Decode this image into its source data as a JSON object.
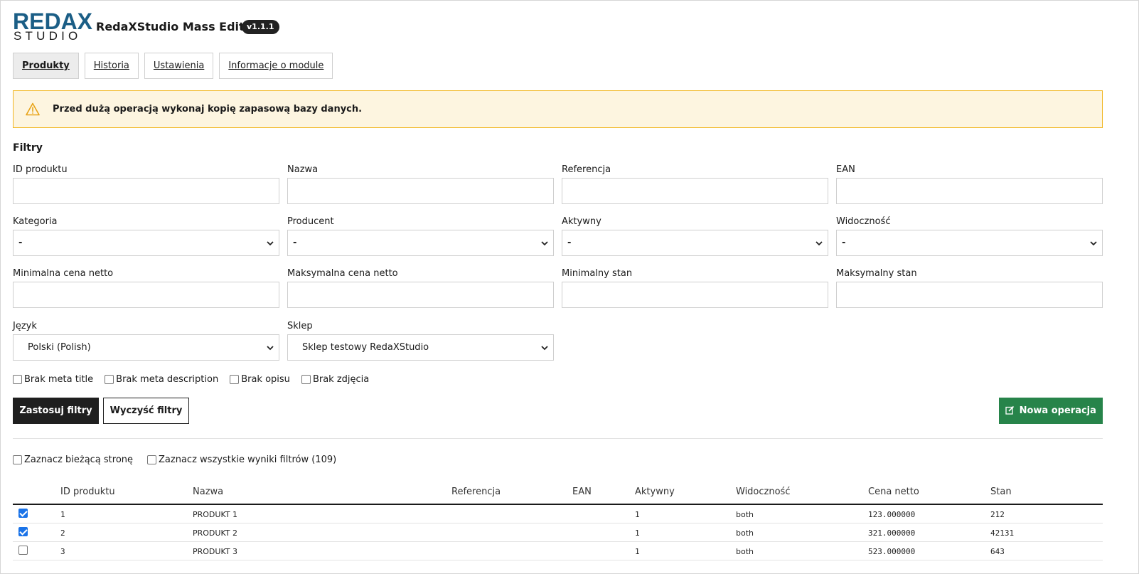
{
  "app": {
    "logo_top": "REDAX",
    "logo_bottom": "STUDIO",
    "title": "RedaXStudio Mass Edit",
    "version": "v1.1.1"
  },
  "tabs": [
    {
      "label": "Produkty",
      "active": true
    },
    {
      "label": "Historia",
      "active": false
    },
    {
      "label": "Ustawienia",
      "active": false
    },
    {
      "label": "Informacje o module",
      "active": false
    }
  ],
  "alert": {
    "icon": "warning-icon",
    "text": "Przed dużą operacją wykonaj kopię zapasową bazy danych."
  },
  "filters": {
    "title": "Filtry",
    "product_id": {
      "label": "ID produktu",
      "value": ""
    },
    "name": {
      "label": "Nazwa",
      "value": ""
    },
    "reference": {
      "label": "Referencja",
      "value": ""
    },
    "ean": {
      "label": "EAN",
      "value": ""
    },
    "category": {
      "label": "Kategoria",
      "value": "-"
    },
    "manufacturer": {
      "label": "Producent",
      "value": "-"
    },
    "active": {
      "label": "Aktywny",
      "value": "-"
    },
    "visibility": {
      "label": "Widoczność",
      "value": "-"
    },
    "min_price": {
      "label": "Minimalna cena netto",
      "value": ""
    },
    "max_price": {
      "label": "Maksymalna cena netto",
      "value": ""
    },
    "min_stock": {
      "label": "Minimalny stan",
      "value": ""
    },
    "max_stock": {
      "label": "Maksymalny stan",
      "value": ""
    },
    "language": {
      "label": "Język",
      "value": "Polski (Polish)"
    },
    "shop": {
      "label": "Sklep",
      "value": "Sklep testowy RedaXStudio"
    },
    "checkboxes": [
      {
        "label": "Brak meta title",
        "checked": false
      },
      {
        "label": "Brak meta description",
        "checked": false
      },
      {
        "label": "Brak opisu",
        "checked": false
      },
      {
        "label": "Brak zdjęcia",
        "checked": false
      }
    ],
    "apply_label": "Zastosuj filtry",
    "clear_label": "Wyczyść filtry",
    "new_operation_label": "Nowa operacja"
  },
  "selection": {
    "current_page_label": "Zaznacz bieżącą stronę",
    "all_results_label": "Zaznacz wszystkie wyniki filtrów (109)"
  },
  "table": {
    "headers": [
      "ID produktu",
      "Nazwa",
      "Referencja",
      "EAN",
      "Aktywny",
      "Widoczność",
      "Cena netto",
      "Stan"
    ],
    "rows": [
      {
        "checked": true,
        "id": "1",
        "name": "PRODUKT 1",
        "reference": "",
        "ean": "",
        "active": "1",
        "visibility": "both",
        "price": "123.000000",
        "stock": "212"
      },
      {
        "checked": true,
        "id": "2",
        "name": "PRODUKT 2",
        "reference": "",
        "ean": "",
        "active": "1",
        "visibility": "both",
        "price": "321.000000",
        "stock": "42131"
      },
      {
        "checked": false,
        "id": "3",
        "name": "PRODUKT 3",
        "reference": "",
        "ean": "",
        "active": "1",
        "visibility": "both",
        "price": "523.000000",
        "stock": "643"
      }
    ]
  },
  "colors": {
    "brand": "#1b5e86",
    "success": "#27844a",
    "alert_bg": "#fdf5e0",
    "alert_border": "#f1b51e"
  }
}
